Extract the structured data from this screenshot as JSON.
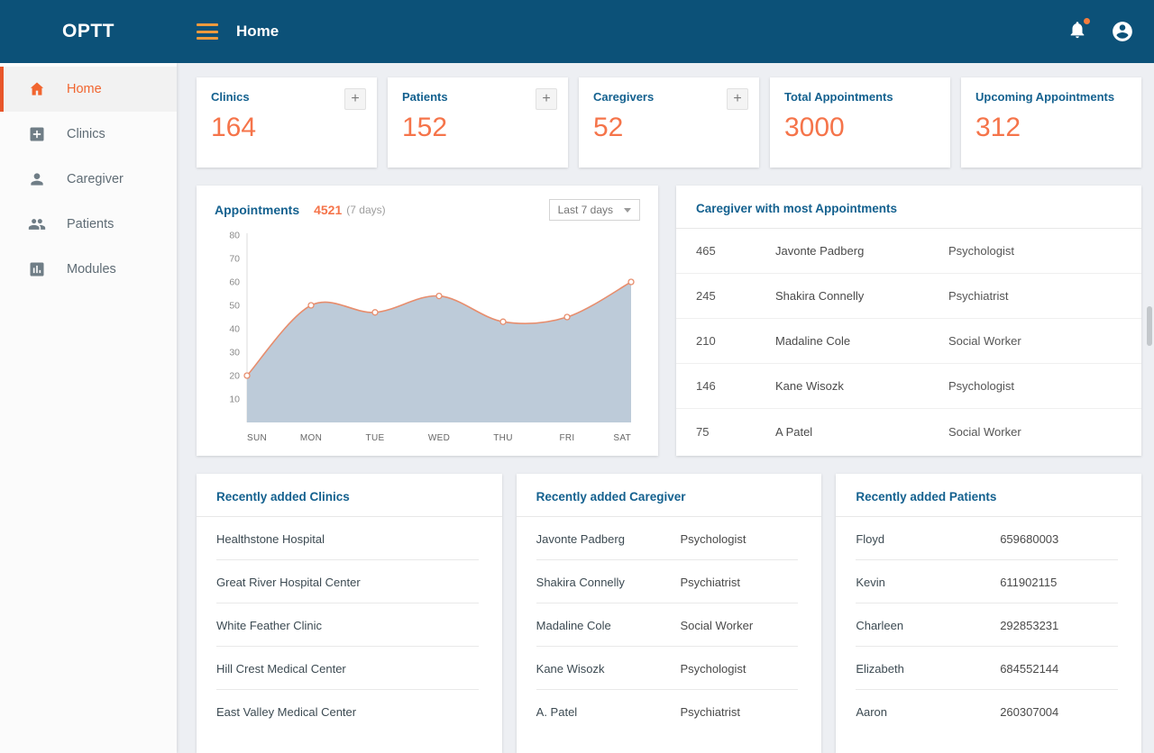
{
  "header": {
    "brand": "OPTT",
    "title": "Home",
    "icons": {
      "menu": "hamburger-icon",
      "notifications": "bell-icon",
      "account": "avatar-icon"
    }
  },
  "sidebar": {
    "items": [
      {
        "label": "Home",
        "icon": "home-icon",
        "active": true
      },
      {
        "label": "Clinics",
        "icon": "add-box-icon",
        "active": false
      },
      {
        "label": "Caregiver",
        "icon": "person-icon",
        "active": false
      },
      {
        "label": "Patients",
        "icon": "people-icon",
        "active": false
      },
      {
        "label": "Modules",
        "icon": "bar-chart-icon",
        "active": false
      }
    ]
  },
  "stats": [
    {
      "label": "Clinics",
      "value": "164",
      "has_add": true
    },
    {
      "label": "Patients",
      "value": "152",
      "has_add": true
    },
    {
      "label": "Caregivers",
      "value": "52",
      "has_add": true
    },
    {
      "label": "Total Appointments",
      "value": "3000",
      "has_add": false
    },
    {
      "label": "Upcoming Appointments",
      "value": "312",
      "has_add": false
    }
  ],
  "appointments_card": {
    "title": "Appointments",
    "count": "4521",
    "period_note": "(7 days)",
    "filter_label": "Last 7 days"
  },
  "chart_data": {
    "type": "area",
    "title": "Appointments (7 days)",
    "categories": [
      "SUN",
      "MON",
      "TUE",
      "WED",
      "THU",
      "FRI",
      "SAT"
    ],
    "values": [
      20,
      50,
      47,
      54,
      43,
      45,
      60
    ],
    "ylim": [
      0,
      80
    ],
    "yticks": [
      10,
      20,
      30,
      40,
      50,
      60,
      70,
      80
    ],
    "grid": false,
    "line_color": "#e78d6d",
    "fill_color": "#b9c8d7",
    "marker_fill": "#ffffff"
  },
  "top_caregivers": {
    "title": "Caregiver with most Appointments",
    "rows": [
      {
        "count": "465",
        "name": "Javonte Padberg",
        "role": "Psychologist"
      },
      {
        "count": "245",
        "name": "Shakira Connelly",
        "role": "Psychiatrist"
      },
      {
        "count": "210",
        "name": "Madaline Cole",
        "role": "Social Worker"
      },
      {
        "count": "146",
        "name": "Kane Wisozk",
        "role": "Psychologist"
      },
      {
        "count": "75",
        "name": "A Patel",
        "role": "Social Worker"
      }
    ]
  },
  "recent_clinics": {
    "title": "Recently added Clinics",
    "items": [
      "Healthstone Hospital",
      "Great River Hospital Center",
      "White Feather Clinic",
      "Hill Crest Medical Center",
      "East Valley Medical Center"
    ]
  },
  "recent_caregivers": {
    "title": "Recently added Caregiver",
    "rows": [
      {
        "name": "Javonte Padberg",
        "role": "Psychologist"
      },
      {
        "name": "Shakira Connelly",
        "role": "Psychiatrist"
      },
      {
        "name": "Madaline Cole",
        "role": "Social Worker"
      },
      {
        "name": "Kane Wisozk",
        "role": "Psychologist"
      },
      {
        "name": "A. Patel",
        "role": "Psychiatrist"
      }
    ]
  },
  "recent_patients": {
    "title": "Recently added Patients",
    "rows": [
      {
        "name": "Floyd",
        "phone": "659680003"
      },
      {
        "name": "Kevin",
        "phone": "611902115"
      },
      {
        "name": "Charleen",
        "phone": "292853231"
      },
      {
        "name": "Elizabeth",
        "phone": "684552144"
      },
      {
        "name": "Aaron",
        "phone": "260307004"
      }
    ]
  },
  "colors": {
    "header_bg": "#0c5178",
    "accent_orange": "#f5744a",
    "title_blue": "#14618f",
    "active_item_bar": "#e8562a",
    "hamburger": "#ef9a3d",
    "content_bg": "#edeff3"
  }
}
